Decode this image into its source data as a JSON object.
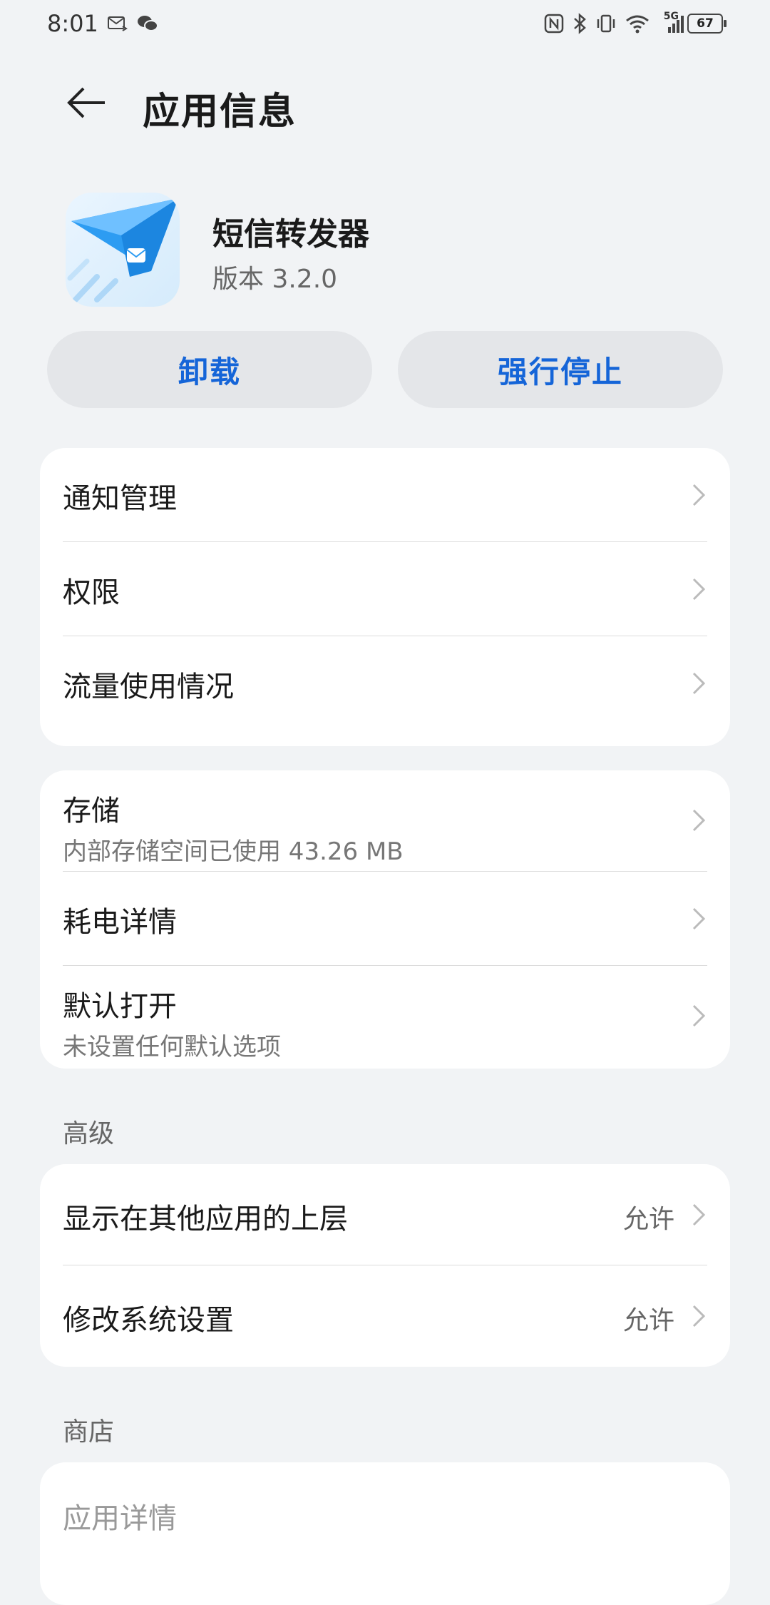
{
  "status_bar": {
    "time": "8:01",
    "left_icons": [
      "mail-icon",
      "wechat-icon"
    ],
    "right_icons": [
      "nfc-icon",
      "bluetooth-icon",
      "vibrate-icon",
      "wifi-icon",
      "5g-signal-icon"
    ],
    "network": "5G",
    "battery": "67"
  },
  "header": {
    "title": "应用信息"
  },
  "app": {
    "name": "短信转发器",
    "version": "版本 3.2.0"
  },
  "actions": {
    "uninstall": "卸载",
    "force_stop": "强行停止"
  },
  "group1": [
    {
      "label": "通知管理"
    },
    {
      "label": "权限"
    },
    {
      "label": "流量使用情况"
    }
  ],
  "group2": [
    {
      "label": "存储",
      "sub": "内部存储空间已使用 43.26 MB"
    },
    {
      "label": "耗电详情"
    },
    {
      "label": "默认打开",
      "sub": "未设置任何默认选项"
    }
  ],
  "advanced": {
    "title": "高级",
    "items": [
      {
        "label": "显示在其他应用的上层",
        "value": "允许"
      },
      {
        "label": "修改系统设置",
        "value": "允许"
      }
    ]
  },
  "store": {
    "title": "商店",
    "items": [
      {
        "label": "应用详情"
      }
    ]
  },
  "colors": {
    "accent": "#1565d8",
    "background": "#f1f3f5",
    "card": "#ffffff"
  }
}
